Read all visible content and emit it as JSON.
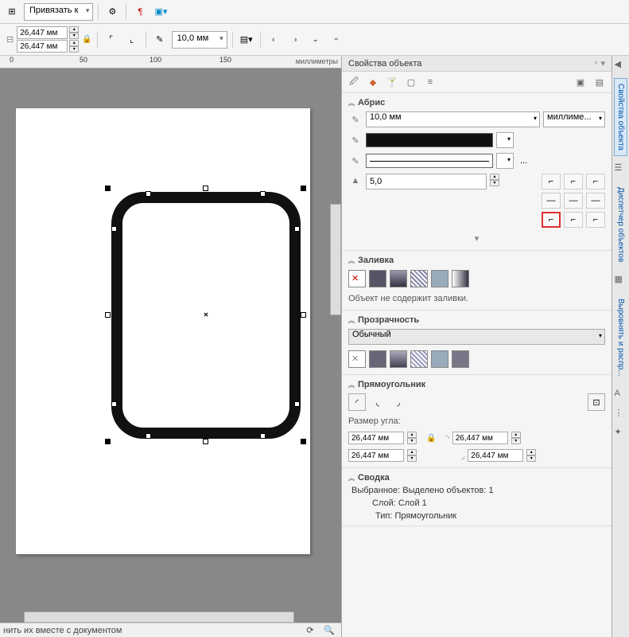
{
  "toolbar": {
    "snap_label": "Привязать к",
    "coords": {
      "w": "26,447 мм",
      "h": "26,447 мм"
    },
    "line_width": "10,0 мм"
  },
  "ruler": {
    "units": "миллиметры",
    "marks": [
      0,
      50,
      100,
      150
    ]
  },
  "panel": {
    "title": "Свойства объекта",
    "sections": {
      "outline": {
        "title": "Абрис",
        "width": "10,0 мм",
        "units": "миллиме...",
        "miter": "5,0",
        "ellipsis": "..."
      },
      "fill": {
        "title": "Заливка",
        "note": "Объект не содержит заливки."
      },
      "transparency": {
        "title": "Прозрачность",
        "mode": "Обычный"
      },
      "rectangle": {
        "title": "Прямоугольник",
        "corner_label": "Размер угла:",
        "c1": "26,447 мм",
        "c2": "26,447 мм",
        "c3": "26,447 мм",
        "c4": "26,447 мм"
      },
      "summary": {
        "title": "Сводка",
        "selected": "Выбранное: Выделено объектов: 1",
        "layer": "Слой: Слой 1",
        "type": "Тип: Прямоугольник"
      }
    }
  },
  "side_tabs": {
    "t1": "Свойства объекта",
    "t2": "Диспетчер объектов",
    "t3": "Выровнять и распр..."
  },
  "status": {
    "text": "нить их вместе с документом"
  }
}
